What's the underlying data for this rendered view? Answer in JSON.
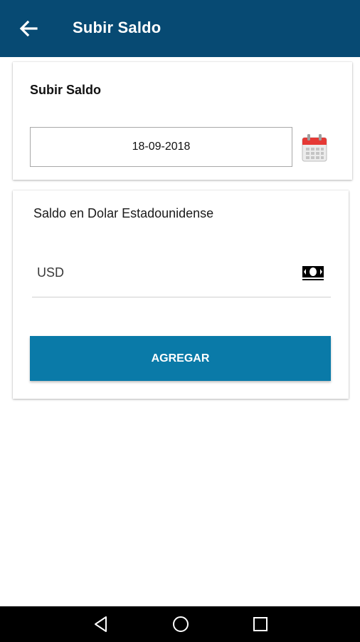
{
  "appbar": {
    "title": "Subir Saldo",
    "back_icon": "arrow-left-icon",
    "color": "#074a73"
  },
  "date_card": {
    "title": "Subir Saldo",
    "date_value": "18-09-2018",
    "calendar_icon": "calendar-icon"
  },
  "balance_card": {
    "label": "Saldo en Dolar Estadounidense",
    "input_placeholder": "USD",
    "money_icon": "money-icon",
    "button_label": "AGREGAR",
    "button_color": "#0a7aa8"
  },
  "navbar": {
    "icons": [
      "nav-back-icon",
      "nav-home-icon",
      "nav-recent-icon"
    ]
  }
}
